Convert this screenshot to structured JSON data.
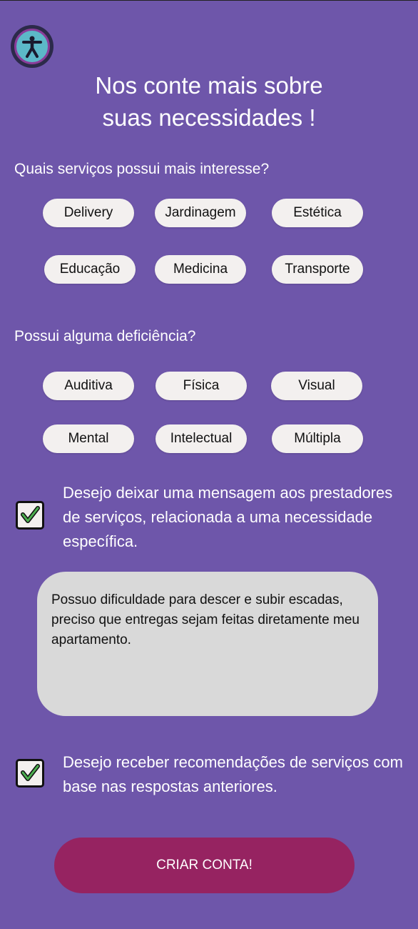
{
  "header": {
    "logo_icon": "accessibility-icon",
    "title_line1": "Nos conte mais sobre",
    "title_line2": "suas necessidades !"
  },
  "services": {
    "question": "Quais serviços possui mais interesse?",
    "options": [
      "Delivery",
      "Jardinagem",
      "Estética",
      "Educação",
      "Medicina",
      "Transporte"
    ]
  },
  "disabilities": {
    "question": "Possui alguma deficiência?",
    "options": [
      "Auditiva",
      "Física",
      "Visual",
      "Mental",
      "Intelectual",
      "Múltipla"
    ]
  },
  "message_option": {
    "checked": true,
    "label": "Desejo deixar uma mensagem aos prestadores de serviços, relacionada a uma necessidade específica."
  },
  "message": {
    "value": "Possuo dificuldade para descer e subir escadas, preciso que entregas sejam feitas diretamente meu apartamento."
  },
  "recommendation_option": {
    "checked": true,
    "label": "Desejo receber recomendações de serviços com base nas respostas anteriores."
  },
  "submit": {
    "label": "CRIAR CONTA!"
  },
  "colors": {
    "background": "#6e56aa",
    "chip": "#f3f0ef",
    "message_box": "#d9d9d9",
    "submit_button": "#962361",
    "check_mark": "#4caf50"
  }
}
